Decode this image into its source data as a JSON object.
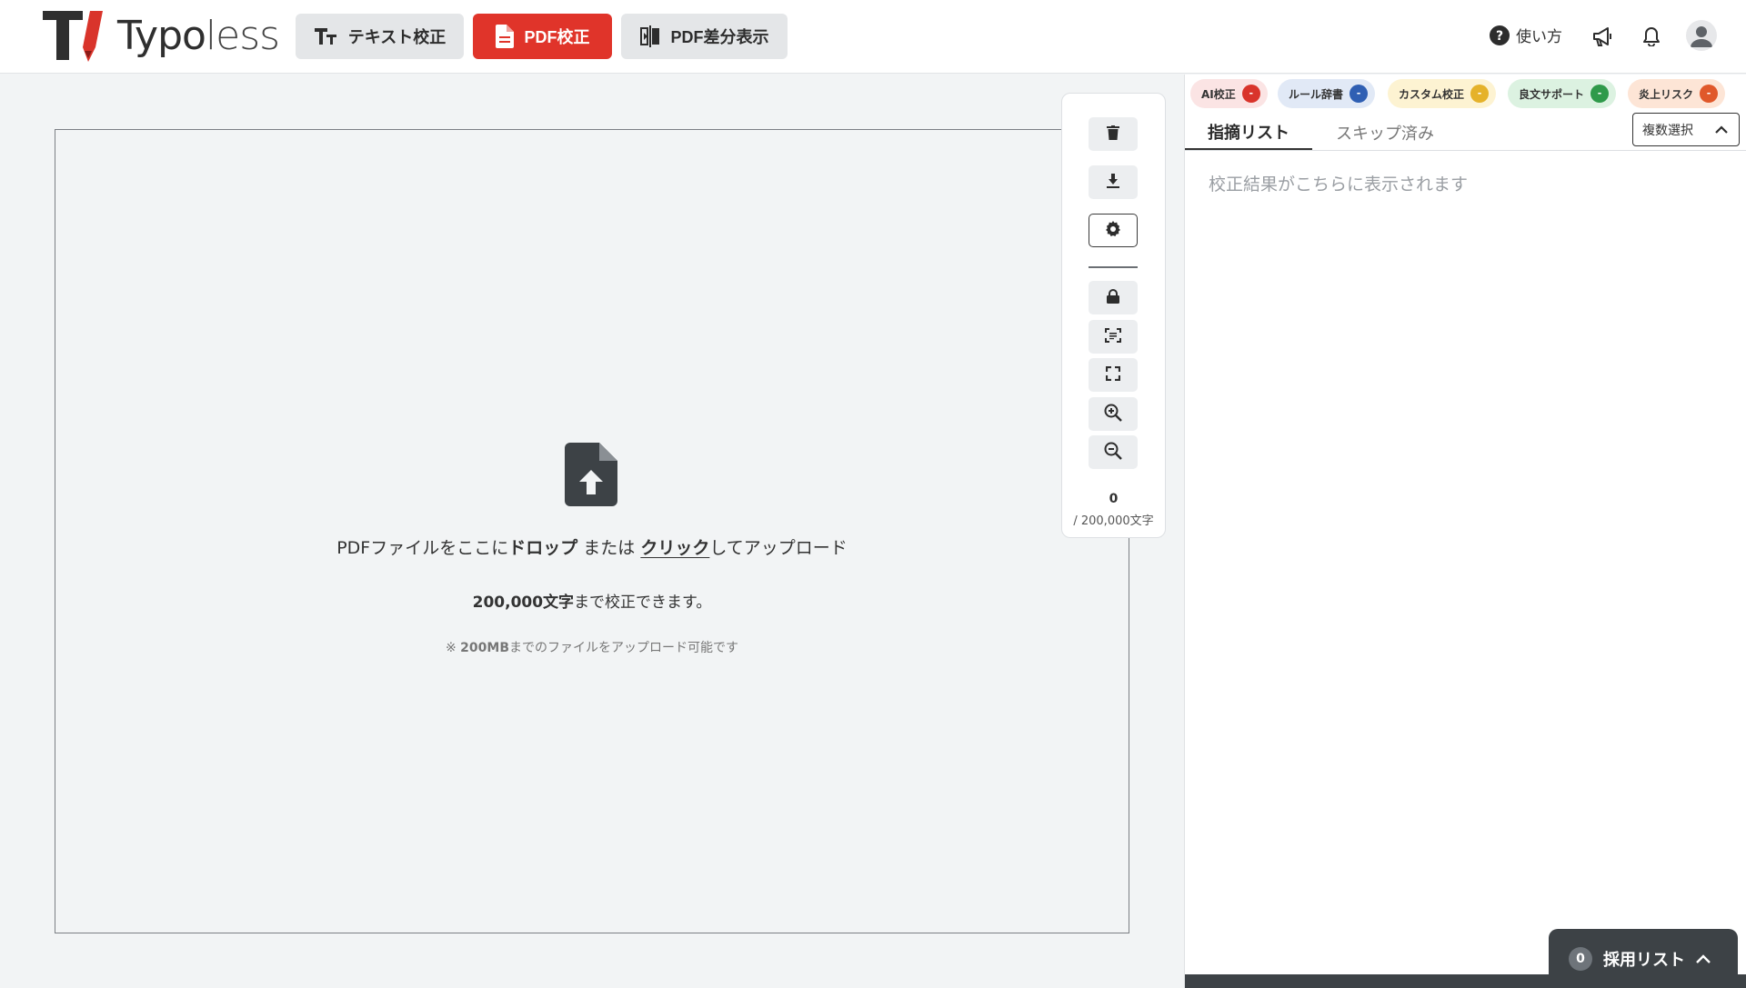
{
  "app": {
    "brand": "Typoless",
    "brand_parts": {
      "typo": "Typo",
      "less": "less"
    }
  },
  "nav": {
    "text_check": "テキスト校正",
    "pdf_check": "PDF校正",
    "pdf_diff": "PDF差分表示"
  },
  "header": {
    "help_label": "使い方",
    "icons": [
      "help-circle-icon",
      "megaphone-icon",
      "bell-icon",
      "user-avatar-icon"
    ]
  },
  "dropzone": {
    "text_before": "PDFファイルをここに",
    "drop": "ドロップ",
    "or": " または ",
    "click": "クリック",
    "text_after": "してアップロード",
    "limit_bold": "200,000文字",
    "limit_rest": "まで校正できます。",
    "note_prefix": "※ ",
    "note_bold": "200MB",
    "note_rest": "までのファイルをアップロード可能です"
  },
  "toolbar": {
    "icons": [
      "trash-icon",
      "download-icon",
      "gear-icon",
      "lock-icon",
      "text-scan-icon",
      "fullscreen-icon",
      "zoom-in-icon",
      "zoom-out-icon"
    ],
    "char_count": "0",
    "char_max": "/ 200,000文字"
  },
  "panel": {
    "chips": [
      {
        "label": "AI校正",
        "value": "-",
        "bg": "#fbe4e4",
        "dot": "#d9342b"
      },
      {
        "label": "ルール辞書",
        "value": "-",
        "bg": "#e1e9f6",
        "dot": "#2f5fb3"
      },
      {
        "label": "カスタム校正",
        "value": "-",
        "bg": "#fdf3d2",
        "dot": "#e5b22a"
      },
      {
        "label": "良文サポート",
        "value": "-",
        "bg": "#dcf2e1",
        "dot": "#2f9a4a"
      },
      {
        "label": "炎上リスク",
        "value": "-",
        "bg": "#fde5d6",
        "dot": "#e0582a"
      }
    ],
    "tab_active": "指摘リスト",
    "tab_skipped": "スキップ済み",
    "multi_select": "複数選択",
    "placeholder": "校正結果がこちらに表示されます"
  },
  "adopt": {
    "count": "0",
    "label": "採用リスト"
  }
}
